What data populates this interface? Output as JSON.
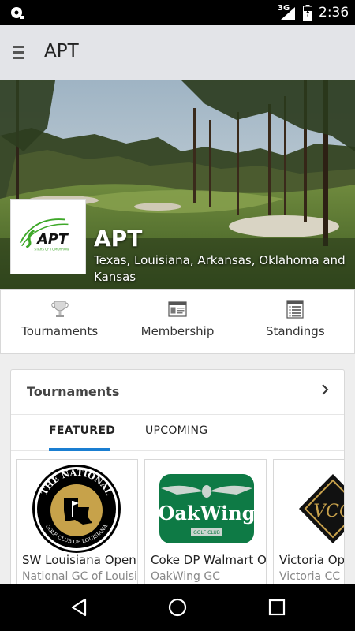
{
  "status_bar": {
    "network": "3G",
    "time": "2:36",
    "icons": [
      "notification-icon",
      "signal-icon",
      "battery-icon"
    ]
  },
  "app_bar": {
    "title": "APT",
    "icons": [
      "menu-icon"
    ]
  },
  "hero": {
    "name": "APT",
    "region": "Texas, Louisiana, Arkansas, Oklahoma and Kansas",
    "logo": {
      "text": "APT",
      "tagline": "STARS OF TOMORROW"
    }
  },
  "actions": [
    {
      "label": "Tournaments",
      "icon": "trophy-icon"
    },
    {
      "label": "Membership",
      "icon": "membership-card-icon"
    },
    {
      "label": "Standings",
      "icon": "standings-list-icon"
    }
  ],
  "tournaments_card": {
    "title": "Tournaments",
    "tabs": [
      "FEATURED",
      "UPCOMING"
    ],
    "active_tab": "FEATURED",
    "colors": {
      "accent": "#1a7ed1"
    },
    "items": [
      {
        "name": "SW Louisiana Open",
        "venue": "National GC of Louisiana",
        "logo": {
          "top_text": "THE NATIONAL",
          "bottom_text": "GOLF CLUB OF LOUISIANA"
        }
      },
      {
        "name": "Coke DP Walmart Open",
        "venue": "OakWing GC",
        "logo": {
          "text": "OakWing",
          "sub": "GOLF CLUB"
        }
      },
      {
        "name": "Victoria Open",
        "venue": "Victoria CC",
        "logo": {
          "text": "VCC"
        }
      }
    ]
  },
  "nav_bar": {
    "icons": [
      "back-icon",
      "home-icon",
      "recents-icon"
    ]
  }
}
